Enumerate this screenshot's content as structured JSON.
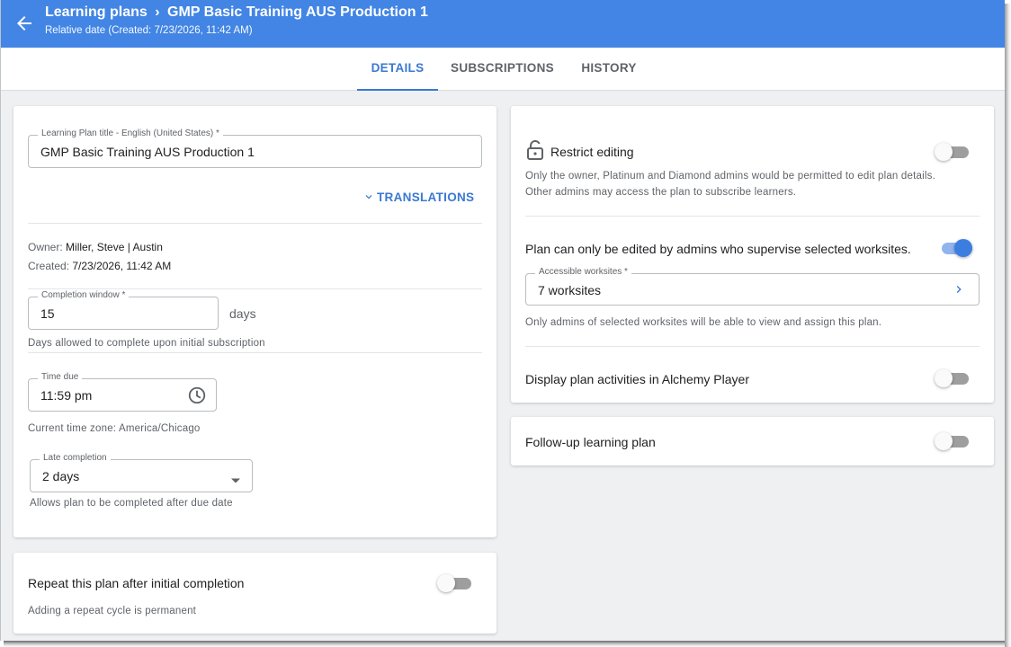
{
  "header": {
    "breadcrumb_root": "Learning plans",
    "breadcrumb_sep": "›",
    "breadcrumb_current": "GMP Basic Training AUS Production 1",
    "subtitle": "Relative date (Created: 7/23/2026, 11:42 AM)"
  },
  "tabs": [
    {
      "label": "DETAILS",
      "active": true
    },
    {
      "label": "SUBSCRIPTIONS",
      "active": false
    },
    {
      "label": "HISTORY",
      "active": false
    }
  ],
  "details": {
    "title_field": {
      "label": "Learning Plan title - English (United States) *",
      "value": "GMP Basic Training AUS Production 1"
    },
    "translations_label": "TRANSLATIONS",
    "owner_label": "Owner:",
    "owner_value": "Miller, Steve | Austin",
    "created_label": "Created:",
    "created_value": "7/23/2026, 11:42 AM",
    "completion_window": {
      "label": "Completion window *",
      "value": "15",
      "unit": "days",
      "helper": "Days allowed to complete upon initial subscription"
    },
    "time_due": {
      "label": "Time due",
      "value": "11:59 pm",
      "helper": "Current time zone: America/Chicago"
    },
    "late_completion": {
      "label": "Late completion",
      "value": "2 days",
      "helper": "Allows plan to be completed after due date"
    }
  },
  "repeat": {
    "title": "Repeat this plan after initial completion",
    "helper": "Adding a repeat cycle is permanent",
    "enabled": false
  },
  "restrictions": {
    "restrict_editing": {
      "title": "Restrict editing",
      "helper_line1": "Only the owner, Platinum and Diamond admins would be permitted to edit plan details.",
      "helper_line2": "Other admins may access the plan to subscribe learners.",
      "enabled": false
    },
    "worksite_edit": {
      "title": "Plan can only be edited by admins who supervise selected worksites.",
      "enabled": true,
      "field_label": "Accessible worksites *",
      "field_value": "7 worksites",
      "helper": "Only admins of selected worksites will be able to view and assign this plan."
    },
    "alchemy_player": {
      "title": "Display plan activities in Alchemy Player",
      "enabled": false
    }
  },
  "follow_up": {
    "title": "Follow-up learning plan",
    "enabled": false
  },
  "colors": {
    "primary": "#4285e4",
    "accent": "#3a79d2",
    "toggle_on": "#3b7ee0"
  },
  "icons": [
    "arrow-back-icon",
    "chevron-down-icon",
    "clock-icon",
    "dropdown-arrow-icon",
    "lock-open-icon",
    "chevron-right-icon"
  ]
}
